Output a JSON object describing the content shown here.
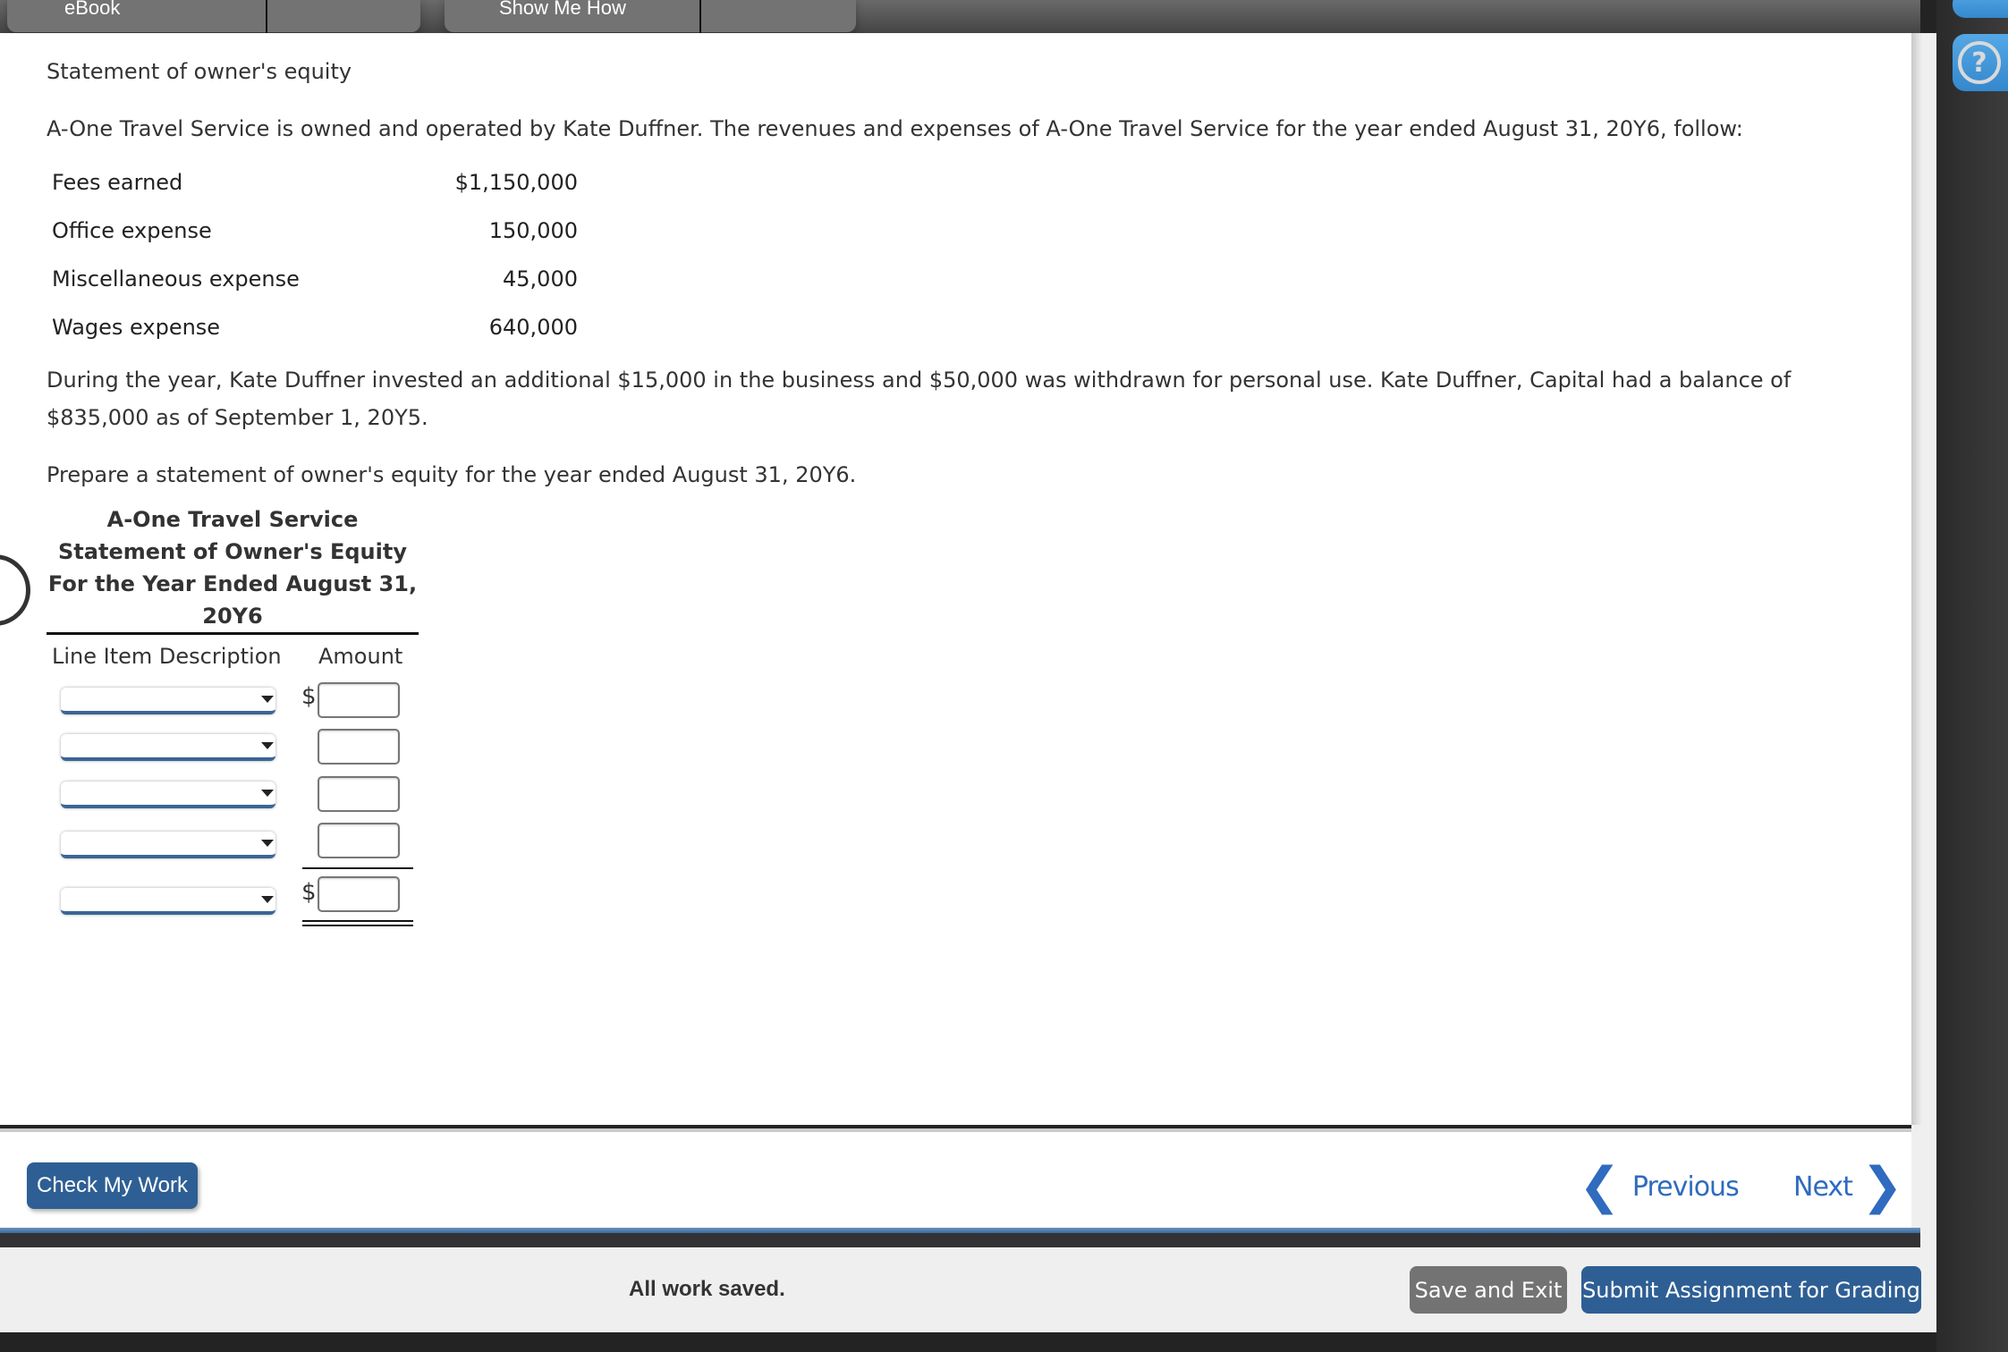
{
  "tabs": [
    {
      "label": "eBook"
    },
    {
      "label": "Show Me How"
    }
  ],
  "sidebar": {
    "tool_icon": "tool-icon",
    "help_icon": "help-icon",
    "help_glyph": "?"
  },
  "problem": {
    "title": "Statement of owner's equity",
    "intro": "A-One Travel Service is owned and operated by Kate Duffner. The revenues and expenses of A-One Travel Service for the year ended August 31, 20Y6, follow:",
    "items": [
      {
        "label": "Fees earned",
        "value": "$1,150,000"
      },
      {
        "label": "Office expense",
        "value": "150,000"
      },
      {
        "label": "Miscellaneous expense",
        "value": "45,000"
      },
      {
        "label": "Wages expense",
        "value": "640,000"
      }
    ],
    "detail_line1": "During the year, Kate Duffner invested an additional $15,000 in the business and $50,000 was withdrawn for personal use. Kate Duffner, Capital had a balance of",
    "detail_line2": "$835,000 as of September 1, 20Y5.",
    "instruction": "Prepare a statement of owner's equity for the year ended August 31, 20Y6."
  },
  "statement": {
    "company": "A-One Travel Service",
    "title": "Statement of Owner's Equity",
    "period_line1": "For the Year Ended August 31,",
    "period_line2": "20Y6",
    "col_description": "Line Item Description",
    "col_amount": "Amount",
    "rows": [
      {
        "description": "",
        "amount": "",
        "dollar": "$"
      },
      {
        "description": "",
        "amount": "",
        "dollar": ""
      },
      {
        "description": "",
        "amount": "",
        "dollar": ""
      },
      {
        "description": "",
        "amount": "",
        "dollar": ""
      },
      {
        "description": "",
        "amount": "",
        "dollar": "$"
      }
    ]
  },
  "nav": {
    "check_my_work": "Check My Work",
    "previous": "Previous",
    "next": "Next",
    "prev_chevron": "❮",
    "next_chevron": "❯"
  },
  "footer": {
    "status": "All work saved.",
    "save_exit": "Save and Exit",
    "submit": "Submit Assignment for Grading"
  },
  "colors": {
    "primary_button": "#2e5f94",
    "link_blue": "#2f6bbf",
    "secondary_button": "#737373"
  }
}
